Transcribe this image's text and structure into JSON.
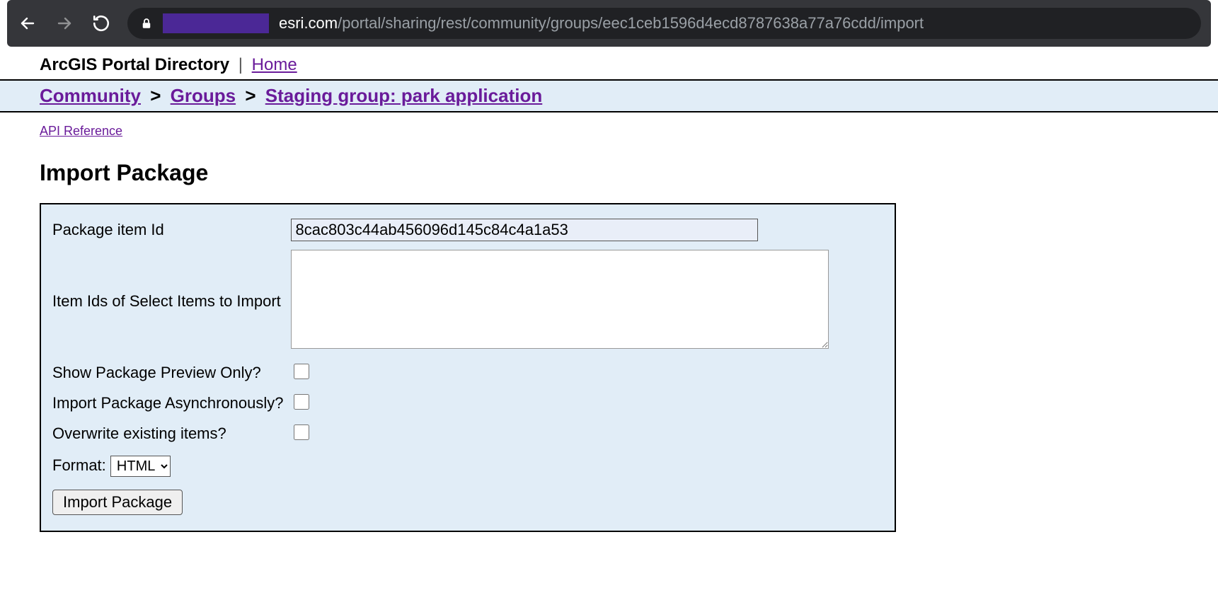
{
  "browser": {
    "url_domain": "esri.com",
    "url_path": "/portal/sharing/rest/community/groups/eec1ceb1596d4ecd8787638a77a76cdd/import"
  },
  "header": {
    "site_title": "ArcGIS Portal Directory",
    "home_label": "Home"
  },
  "breadcrumb": {
    "segments": [
      "Community",
      "Groups",
      "Staging group: park application"
    ]
  },
  "api_link": "API Reference",
  "page_heading": "Import Package",
  "form": {
    "package_id_label": "Package item Id",
    "package_id_value": "8cac803c44ab456096d145c84c4a1a53",
    "item_ids_label": "Item Ids of Select Items to Import",
    "item_ids_value": "",
    "preview_label": "Show Package Preview Only?",
    "async_label": "Import Package Asynchronously?",
    "overwrite_label": "Overwrite existing items?",
    "format_label": "Format:",
    "format_selected": "HTML",
    "submit_label": "Import Package"
  }
}
